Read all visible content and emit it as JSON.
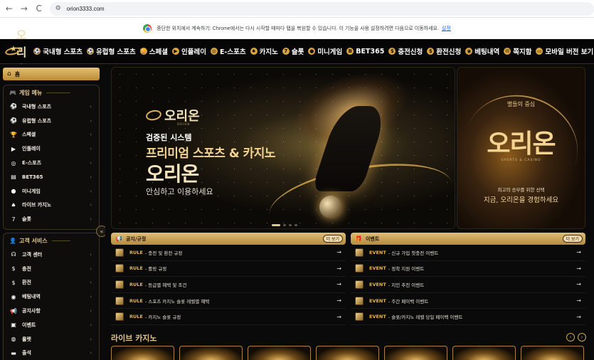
{
  "browser": {
    "url": "orion3333.com",
    "nav_back": "←",
    "nav_forward": "→",
    "nav_reload": "C",
    "info_text": "중단한 위치에서 계속하기: Chrome에서는 다시 시작할 때마다 탭을 복원할 수 있습니다. 이 기능을 사용 설정하려면 다음으로 이동하세요.",
    "info_link": "설정"
  },
  "header": {
    "logo_text": "오리온",
    "nav": [
      {
        "icon": "⚽",
        "label": "국내형 스포츠"
      },
      {
        "icon": "⚽",
        "label": "유럽형 스포츠"
      },
      {
        "icon": "🏆",
        "label": "스페셜"
      },
      {
        "icon": "▶",
        "label": "인플레이"
      },
      {
        "icon": "◎",
        "label": "E-스포츠"
      },
      {
        "icon": "♠",
        "label": "카지노"
      },
      {
        "icon": "7",
        "label": "슬롯"
      },
      {
        "icon": "●",
        "label": "미니게임"
      },
      {
        "icon": "B",
        "label": "BET365"
      },
      {
        "icon": "$",
        "label": "충전신청"
      },
      {
        "icon": "$",
        "label": "환전신청"
      },
      {
        "icon": "◉",
        "label": "베팅내역"
      },
      {
        "icon": "✉",
        "label": "쪽지함"
      },
      {
        "icon": "▭",
        "label": "모바일 버전 보기"
      }
    ]
  },
  "sidebar": {
    "home_label": "홈",
    "game_menu_title": "게임 메뉴",
    "game_items": [
      {
        "icon": "⚽",
        "label": "국내형 스포츠"
      },
      {
        "icon": "⚽",
        "label": "유럽형 스포츠"
      },
      {
        "icon": "🏆",
        "label": "스페셜"
      },
      {
        "icon": "▶",
        "label": "인플레이"
      },
      {
        "icon": "◎",
        "label": "E-스포츠"
      },
      {
        "icon": "▤",
        "label": "BET365"
      },
      {
        "icon": "●",
        "label": "미니게임"
      },
      {
        "icon": "♠",
        "label": "라이브 카지노"
      },
      {
        "icon": "7",
        "label": "슬롯"
      }
    ],
    "service_title": "고객 서비스",
    "service_items": [
      {
        "icon": "☊",
        "label": "고객 센터"
      },
      {
        "icon": "$",
        "label": "충전"
      },
      {
        "icon": "$",
        "label": "환전"
      },
      {
        "icon": "◉",
        "label": "베팅내역"
      },
      {
        "icon": "📢",
        "label": "공지사항"
      },
      {
        "icon": "▣",
        "label": "이벤트"
      },
      {
        "icon": "◍",
        "label": "룰렛"
      },
      {
        "icon": "▬",
        "label": "출석"
      }
    ],
    "chevron": "›",
    "collapse_icon": "«"
  },
  "banner_main": {
    "logo_text": "오리온",
    "logo_sub": "ORION",
    "line1": "검증된 시스템",
    "line2": "프리미엄 스포츠 & 카지노",
    "line3": "오리온",
    "line4": "안심하고 이용하세요"
  },
  "banner_side": {
    "top": "별들의 중심",
    "big": "오리온",
    "sub": "SPORTS & CASINO",
    "l1": "최고의 승부를 위한 선택",
    "l2": "지금, 오리온을 경험하세요"
  },
  "notice": {
    "title": "공지/규정",
    "more": "더 보기",
    "rows": [
      {
        "tag": "RULE",
        "text": "- 충전 및 환전 규정"
      },
      {
        "tag": "RULE",
        "text": "- 롤링 규정"
      },
      {
        "tag": "RULE",
        "text": "- 등급별 혜택 및 조건"
      },
      {
        "tag": "RULE",
        "text": "- 스포츠 카지노 슬롯 레벨별 혜택"
      },
      {
        "tag": "RULE",
        "text": "- 카지노 슬롯 규정"
      }
    ]
  },
  "event": {
    "title": "이벤트",
    "more": "더 보기",
    "rows": [
      {
        "tag": "EVENT",
        "text": "- 신규 가입 첫충전 이벤트"
      },
      {
        "tag": "EVENT",
        "text": "- 정착 지원 이벤트"
      },
      {
        "tag": "EVENT",
        "text": "- 지인 추천 이벤트"
      },
      {
        "tag": "EVENT",
        "text": "- 주간 페이백 이벤트"
      },
      {
        "tag": "EVENT",
        "text": "- 슬롯/카지노 레벨 당일 페이백 이벤트"
      }
    ]
  },
  "row_arrow": "→",
  "live": {
    "title": "라이브 카지노",
    "prev": "‹",
    "next": "›"
  },
  "colors": {
    "accent_gold": "#d9a441",
    "background": "#0b0b0b",
    "tag_gold": "#e6b54e"
  }
}
